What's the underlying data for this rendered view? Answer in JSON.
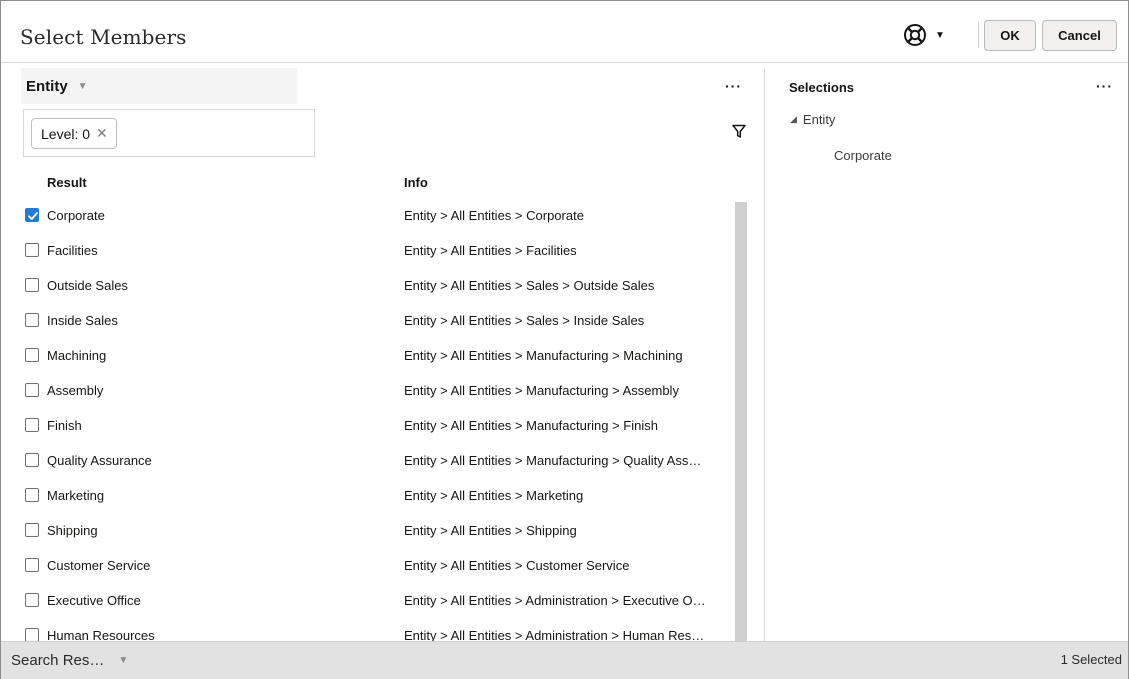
{
  "header": {
    "title": "Select Members",
    "help_icon": "lifebuoy-icon",
    "ok_label": "OK",
    "cancel_label": "Cancel"
  },
  "left_panel": {
    "dimension_label": "Entity",
    "more_label": "···",
    "filter_chip_label": "Level: 0",
    "chip_close": "✕",
    "columns": {
      "result": "Result",
      "info": "Info"
    },
    "rows": [
      {
        "name": "Corporate",
        "info": "Entity > All Entities > Corporate",
        "checked": true
      },
      {
        "name": "Facilities",
        "info": "Entity > All Entities > Facilities",
        "checked": false
      },
      {
        "name": "Outside Sales",
        "info": "Entity > All Entities > Sales > Outside Sales",
        "checked": false
      },
      {
        "name": "Inside Sales",
        "info": "Entity > All Entities > Sales > Inside Sales",
        "checked": false
      },
      {
        "name": "Machining",
        "info": "Entity > All Entities > Manufacturing > Machining",
        "checked": false
      },
      {
        "name": "Assembly",
        "info": "Entity > All Entities > Manufacturing > Assembly",
        "checked": false
      },
      {
        "name": "Finish",
        "info": "Entity > All Entities > Manufacturing > Finish",
        "checked": false
      },
      {
        "name": "Quality Assurance",
        "info": "Entity > All Entities > Manufacturing > Quality Ass…",
        "checked": false
      },
      {
        "name": "Marketing",
        "info": "Entity > All Entities > Marketing",
        "checked": false
      },
      {
        "name": "Shipping",
        "info": "Entity > All Entities > Shipping",
        "checked": false
      },
      {
        "name": "Customer Service",
        "info": "Entity > All Entities > Customer Service",
        "checked": false
      },
      {
        "name": "Executive Office",
        "info": "Entity > All Entities > Administration > Executive O…",
        "checked": false
      },
      {
        "name": "Human Resources",
        "info": "Entity > All Entities > Administration > Human Res…",
        "checked": false
      }
    ]
  },
  "right_panel": {
    "title": "Selections",
    "more_label": "···",
    "tree_root": "Entity",
    "tree_children": [
      "Corporate"
    ]
  },
  "footer": {
    "search_label": "Search Res…",
    "selected_count": "1 Selected"
  },
  "colors": {
    "accent": "#227bd4",
    "button_bg": "#f1f0ee",
    "footer_bg": "#e2e2e2",
    "scrollbar": "#cfcfcf"
  }
}
